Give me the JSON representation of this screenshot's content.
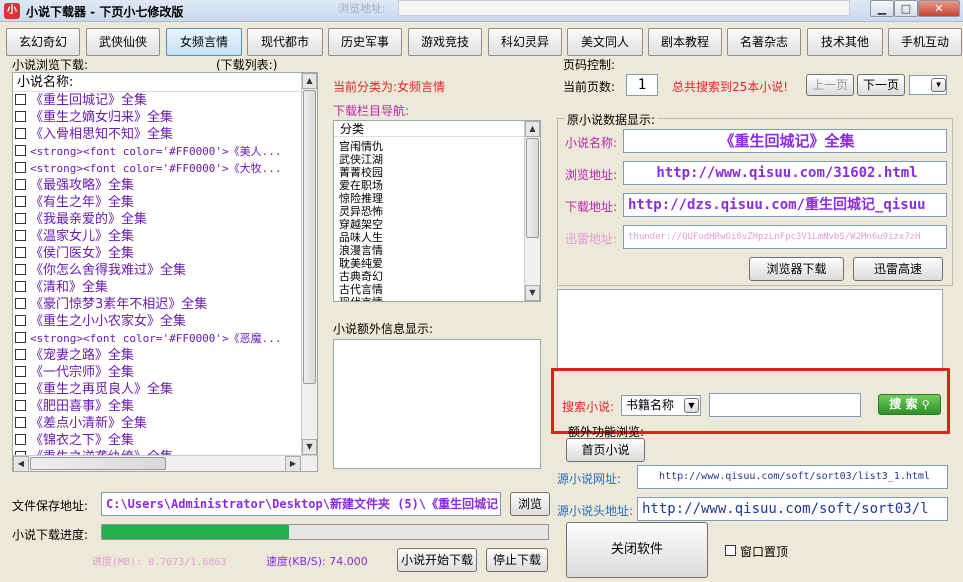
{
  "window": {
    "title": "小说下载器 - 下页小七修改版",
    "ghost_label": "浏览地址:",
    "min": "▁",
    "max": "□",
    "close": "✕"
  },
  "tabs": [
    "玄幻奇幻",
    "武侠仙侠",
    "女频言情",
    "现代都市",
    "历史军事",
    "游戏竞技",
    "科幻灵异",
    "美文同人",
    "剧本教程",
    "名著杂志",
    "技术其他",
    "手机互动"
  ],
  "left": {
    "browse_label": "小说浏览下载:",
    "download_list_label": "(下载列表:)",
    "list_header": "小说名称:",
    "items": [
      "《重生回城记》全集",
      "《重生之嫡女归来》全集",
      "《入骨相思知不知》全集",
      "<strong><font color='#FF0000'>《美人...",
      "<strong><font color='#FF0000'>《大牧...",
      "《最强攻略》全集",
      "《有生之年》全集",
      "《我最亲爱的》全集",
      "《温家女儿》全集",
      "《侯门医女》全集",
      "《你怎么舍得我难过》全集",
      "《清和》全集",
      "《豪门惊梦3素年不相迟》全集",
      "《重生之小小农家女》全集",
      "<strong><font color='#FF0000'>《恶魔...",
      "《宠妻之路》全集",
      "《一代宗师》全集",
      "《重生之再觅良人》全集",
      "《肥田喜事》全集",
      "《差点小清新》全集",
      "《锦衣之下》全集",
      "《重生之逆袭纨绔》全集"
    ]
  },
  "middle": {
    "current_category": "当前分类为:女频言情",
    "nav_label": "下载栏目导航:",
    "cat_header": "分类",
    "categories": [
      "宫闱情仇",
      "武侠江湖",
      "菁菁校园",
      "爱在职场",
      "惊险推理",
      "灵异恐怖",
      "穿越架空",
      "品味人生",
      "浪漫言情",
      "耽美纯爱",
      "古典奇幻",
      "古代言情",
      "现代言情"
    ],
    "extra_label": "小说额外信息显示:"
  },
  "paging": {
    "label": "页码控制:",
    "current_label": "当前页数:",
    "current_value": "1",
    "total_text": "总共搜索到25本小说!",
    "prev": "上一页",
    "next": "下一页"
  },
  "info": {
    "group_label": "原小说数据显示:",
    "name_label": "小说名称:",
    "name_value": "《重生回城记》全集",
    "browse_label": "浏览地址:",
    "browse_value": "http://www.qisuu.com/31602.html",
    "download_label": "下载地址:",
    "download_value": "http://dzs.qisuu.com/重生回城记_qisuu",
    "thunder_label": "迅雷地址:",
    "thunder_value": "thunder://QUFodHRwOi8vZHpzLnFpc3V1LmNvbS/W2Mn6u9izx7zH",
    "browser_download": "浏览器下载",
    "thunder_download": "迅雷高速"
  },
  "search": {
    "label": "搜索小说:",
    "select_value": "书籍名称",
    "button": "搜 索"
  },
  "extra": {
    "label": "额外功能浏览:",
    "home_button": "首页小说",
    "source_url_label": "源小说网址:",
    "source_url_value": "http://www.qisuu.com/soft/sort03/list3_1.html",
    "source_head_label": "源小说头地址:",
    "source_head_value": "http://www.qisuu.com/soft/sort03/l",
    "close_button": "关闭软件",
    "topmost_label": "窗口置顶"
  },
  "bottom": {
    "save_label": "文件保存地址:",
    "save_value": "C:\\Users\\Administrator\\Desktop\\新建文件夹 (5)\\《重生回城记",
    "browse_button": "浏览",
    "progress_label": "小说下载进度:",
    "progress_fraction": 0.42,
    "progress_text": "进度(MB): 0.7073/1.6863",
    "speed_text": "速度(KB/S): 74.000",
    "start_button": "小说开始下载",
    "stop_button": "停止下载"
  },
  "colors": {
    "accent_red": "#e8232a",
    "purple": "#8b2be2",
    "progress_green": "#22b14c",
    "highlight_box": "#e0201c"
  }
}
